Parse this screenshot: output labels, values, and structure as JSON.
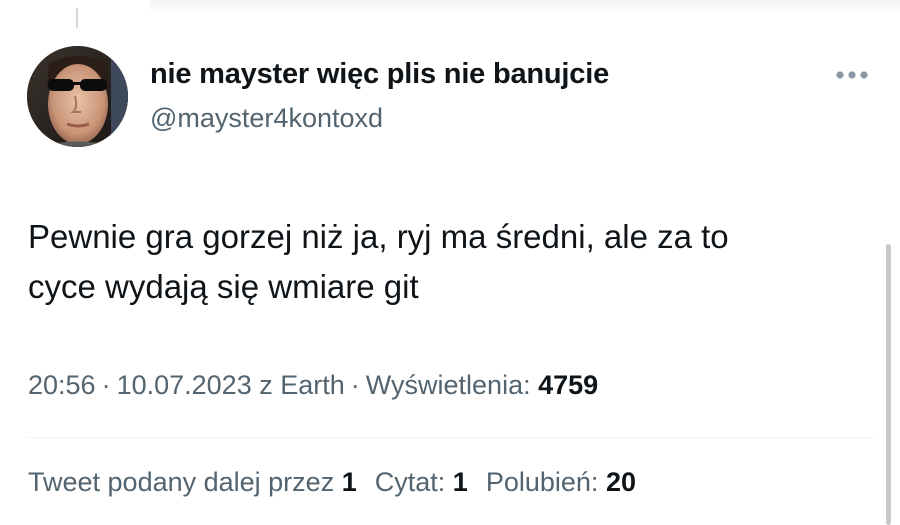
{
  "author": {
    "display_name": "nie mayster więc plis nie banujcie",
    "handle": "@mayster4kontoxd"
  },
  "tweet": {
    "text_line1": "Pewnie gra gorzej niż ja, ryj ma średni, ale za to",
    "text_line2": "cyce wydają się wmiare git"
  },
  "meta": {
    "time": "20:56",
    "date": "10.07.2023",
    "source": "z Earth",
    "views_label": "Wyświetlenia:",
    "views_count": "4759",
    "separator": "·"
  },
  "stats": {
    "retweets_label": "Tweet podany dalej przez",
    "retweets_count": "1",
    "quotes_label": "Cytat:",
    "quotes_count": "1",
    "likes_label": "Polubień:",
    "likes_count": "20"
  },
  "icons": {
    "more": "more-horizontal-icon"
  },
  "colors": {
    "text_primary": "#0f1419",
    "text_secondary": "#536471",
    "divider": "#eff3f4",
    "more_icon": "#8b98a5"
  }
}
